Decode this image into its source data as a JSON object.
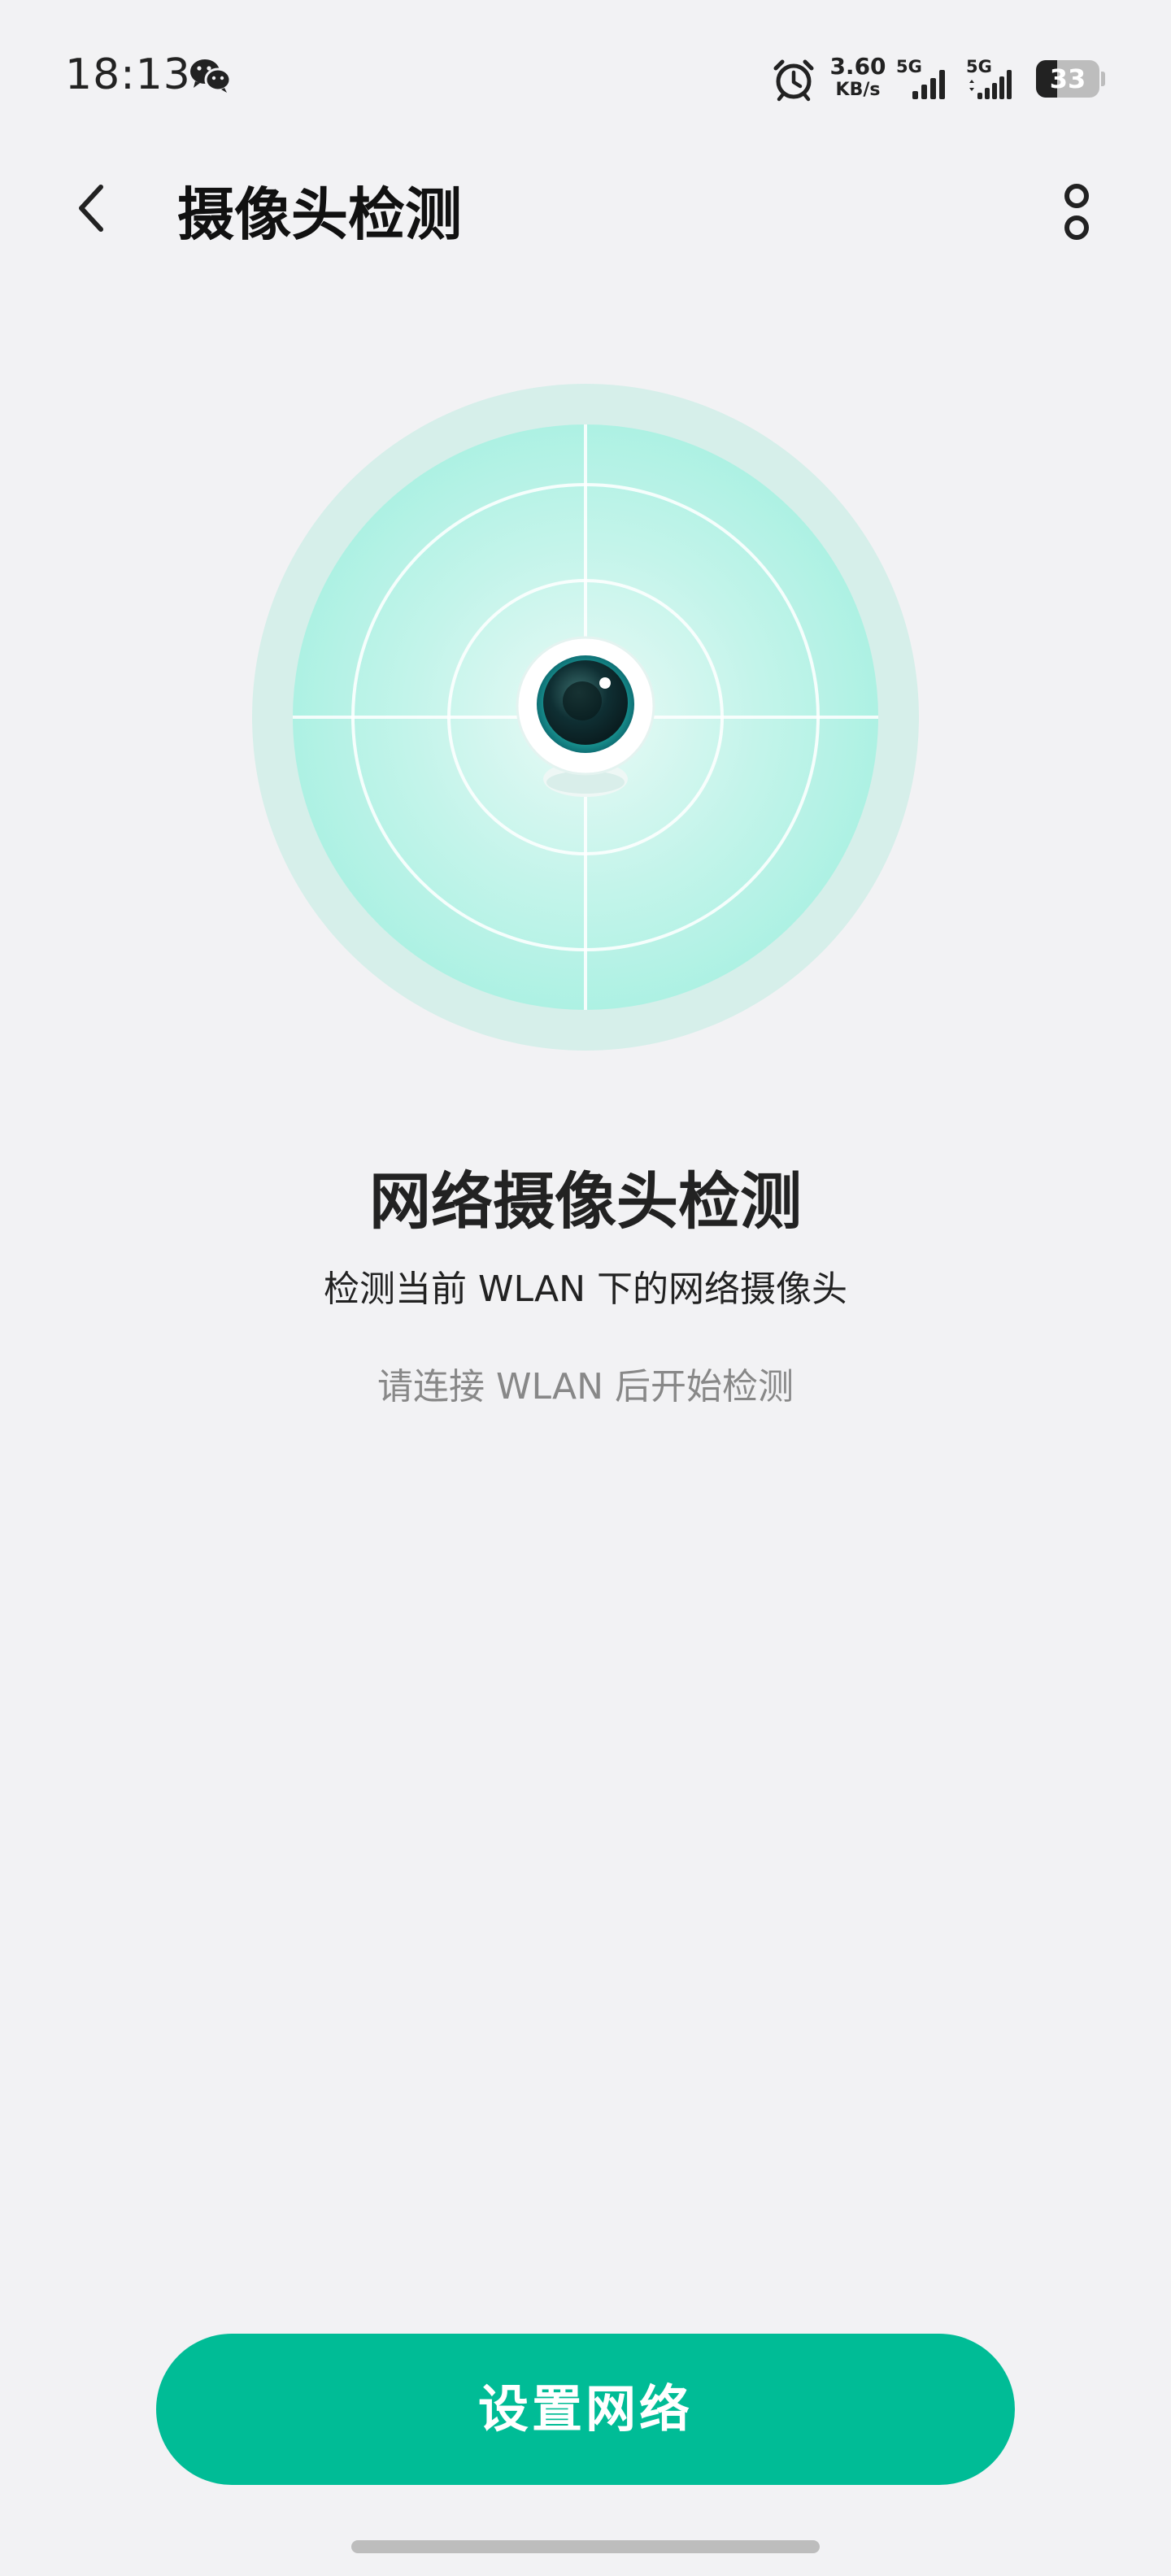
{
  "status_bar": {
    "time": "18:13",
    "net_speed_value": "3.60",
    "net_speed_unit": "KB/s",
    "sim1_label": "5G",
    "sim2_label": "5G",
    "battery_level": "33",
    "battery_fraction": 0.33,
    "icons": [
      "wechat-icon",
      "alarm-clock-icon",
      "signal-icon",
      "battery-icon"
    ]
  },
  "header": {
    "title": "摄像头检测",
    "back_icon": "chevron-left-icon",
    "more_icon": "more-vertical-icon"
  },
  "illustration": {
    "icon": "camera-icon",
    "accent_color": "#00bc96",
    "radar_color": "#b2f2e5"
  },
  "main": {
    "heading": "网络摄像头检测",
    "subtitle": "检测当前 WLAN 下的网络摄像头",
    "hint": "请连接 WLAN 后开始检测"
  },
  "footer": {
    "button_label": "设置网络",
    "button_color": "#00bc96"
  }
}
